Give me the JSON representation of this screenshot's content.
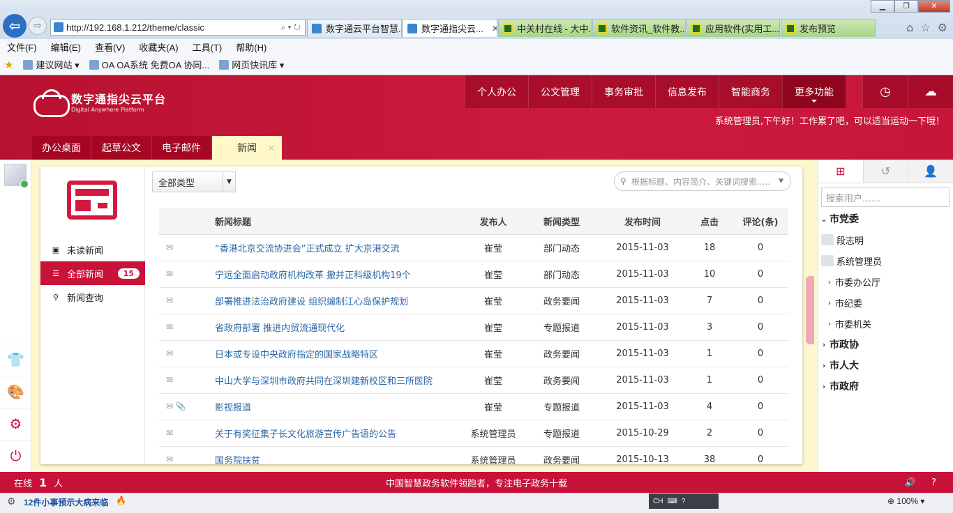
{
  "browser": {
    "url": "http://192.168.1.212/theme/classic",
    "tabs": [
      {
        "label": "数字通云平台智慧...",
        "active": false,
        "style": "blue"
      },
      {
        "label": "数字通指尖云...",
        "active": true,
        "style": "blue"
      },
      {
        "label": "中关村在线 - 大中...",
        "active": false,
        "style": "green"
      },
      {
        "label": "软件资讯_软件教...",
        "active": false,
        "style": "green"
      },
      {
        "label": "应用软件(实用工...",
        "active": false,
        "style": "green"
      },
      {
        "label": "发布预览",
        "active": false,
        "style": "green"
      }
    ],
    "menu": [
      "文件(F)",
      "编辑(E)",
      "查看(V)",
      "收藏夹(A)",
      "工具(T)",
      "帮助(H)"
    ],
    "favorites": [
      "建议网站 ▾",
      "OA OA系统 免费OA 协同...",
      "网页快讯库 ▾"
    ],
    "status_message": "12件小事预示大病来临",
    "ime": "CH",
    "zoom": "100%"
  },
  "app": {
    "logo_title": "数字通指尖云平台",
    "logo_subtitle": "Digital Anywhere Platform",
    "nav": [
      "个人办公",
      "公文管理",
      "事务审批",
      "信息发布",
      "智能商务",
      "更多功能"
    ],
    "greeting": "系统管理员,下午好！工作累了吧，可以适当运动一下哦！",
    "tabs": [
      "办公桌面",
      "起草公文",
      "电子邮件",
      "新闻"
    ],
    "tab_close": "×"
  },
  "sidebar": {
    "items": [
      {
        "label": "未读新闻",
        "icon": "news-icon"
      },
      {
        "label": "全部新闻",
        "icon": "list-icon",
        "badge": "15"
      },
      {
        "label": "新闻查询",
        "icon": "search-icon"
      }
    ]
  },
  "filter": {
    "type_select": "全部类型",
    "search_placeholder": "根据标题、内容简介、关键词搜索....."
  },
  "table": {
    "headers": [
      "新闻标题",
      "发布人",
      "新闻类型",
      "发布时间",
      "点击",
      "评论(条)"
    ],
    "rows": [
      {
        "title": "“香港北京交流协进会”正式成立 扩大京港交流",
        "author": "崔莹",
        "type": "部门动态",
        "date": "2015-11-03",
        "clicks": "18",
        "comments": "0",
        "attach": false
      },
      {
        "title": "宁远全面启动政府机构改革 撤并正科级机构19个",
        "author": "崔莹",
        "type": "部门动态",
        "date": "2015-11-03",
        "clicks": "10",
        "comments": "0",
        "attach": false
      },
      {
        "title": "部署推进法治政府建设 组织编制江心岛保护规划",
        "author": "崔莹",
        "type": "政务要闻",
        "date": "2015-11-03",
        "clicks": "7",
        "comments": "0",
        "attach": false
      },
      {
        "title": "省政府部署 推进内贸流通现代化",
        "author": "崔莹",
        "type": "专题报道",
        "date": "2015-11-03",
        "clicks": "3",
        "comments": "0",
        "attach": false
      },
      {
        "title": "日本或专设中央政府指定的国家战略特区",
        "author": "崔莹",
        "type": "政务要闻",
        "date": "2015-11-03",
        "clicks": "1",
        "comments": "0",
        "attach": false
      },
      {
        "title": "中山大学与深圳市政府共同在深圳建新校区和三所医院",
        "author": "崔莹",
        "type": "政务要闻",
        "date": "2015-11-03",
        "clicks": "1",
        "comments": "0",
        "attach": false
      },
      {
        "title": "影视报道",
        "author": "崔莹",
        "type": "专题报道",
        "date": "2015-11-03",
        "clicks": "4",
        "comments": "0",
        "attach": true
      },
      {
        "title": "关于有奖征集子长文化旅游宣传广告语的公告",
        "author": "系统管理员",
        "type": "专题报道",
        "date": "2015-10-29",
        "clicks": "2",
        "comments": "0",
        "attach": false
      },
      {
        "title": "国务院扶贫",
        "author": "系统管理员",
        "type": "政务要闻",
        "date": "2015-10-13",
        "clicks": "38",
        "comments": "0",
        "attach": false
      }
    ]
  },
  "orgtree": {
    "search_placeholder": "搜索用户……",
    "nodes": [
      {
        "label": "市党委",
        "level": "top",
        "caret": "⌄"
      },
      {
        "label": "段志明",
        "level": "user"
      },
      {
        "label": "系统管理员",
        "level": "user"
      },
      {
        "label": "市委办公厅",
        "level": "sub",
        "caret": "›"
      },
      {
        "label": "市纪委",
        "level": "sub",
        "caret": "›"
      },
      {
        "label": "市委机关",
        "level": "sub",
        "caret": "›"
      },
      {
        "label": "市政协",
        "level": "top",
        "caret": "›"
      },
      {
        "label": "市人大",
        "level": "top",
        "caret": "›"
      },
      {
        "label": "市政府",
        "level": "top",
        "caret": "›"
      }
    ]
  },
  "footer": {
    "online_label": "在线",
    "online_count": "1",
    "online_unit": "人",
    "slogan": "中国智慧政务软件领跑者，专注电子政务十载"
  },
  "colors": {
    "brand": "#c8123a",
    "link": "#2a68a8",
    "panel_bg": "#fdf6cf"
  }
}
